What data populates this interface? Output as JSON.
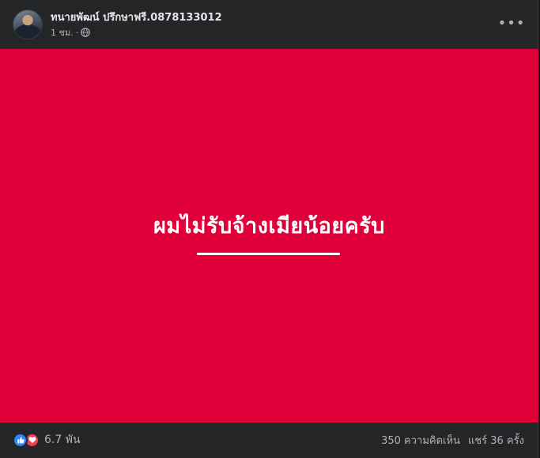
{
  "post": {
    "author": "ทนายพัฒน์ ปรึกษาฟรี.0878133012",
    "time": "1 ชม.",
    "separator": "·",
    "privacy_icon": "globe-icon",
    "more_icon": "more-options-icon",
    "more_label": "•••"
  },
  "banner": {
    "text": "ผมไม่รับจ้างเมียน้อยครับ",
    "background_color": "#e0003a"
  },
  "footer": {
    "reaction_icons": [
      "like-icon",
      "love-icon"
    ],
    "reaction_count": "6.7 พัน",
    "comments": "350 ความคิดเห็น",
    "shares": "แชร์ 36 ครั้ง"
  }
}
